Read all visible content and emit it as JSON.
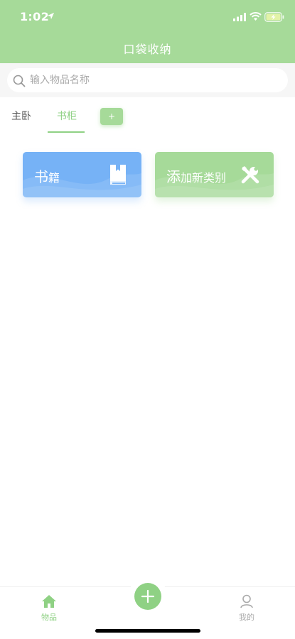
{
  "status_bar": {
    "time": "1:02"
  },
  "header": {
    "title": "口袋收纳"
  },
  "search": {
    "placeholder": "输入物品名称"
  },
  "tabs": [
    {
      "label": "主卧",
      "active": false
    },
    {
      "label": "书柜",
      "active": true
    }
  ],
  "add_tab": {
    "label": "+"
  },
  "cards": [
    {
      "label_main": "书",
      "label_small": "籍",
      "icon": "book-icon",
      "color": "#76b2f6"
    },
    {
      "label_main": "添",
      "label_small": "加新类别",
      "icon": "tools-icon",
      "color": "#a6da99"
    }
  ],
  "bottom_nav": {
    "items": [
      {
        "label": "物品",
        "icon": "home-icon",
        "active": true
      },
      {
        "label": "我的",
        "icon": "user-icon",
        "active": false
      }
    ],
    "fab_icon": "plus-icon"
  },
  "colors": {
    "primary": "#a6da99",
    "accent": "#8fd184",
    "blue": "#76b2f6"
  }
}
